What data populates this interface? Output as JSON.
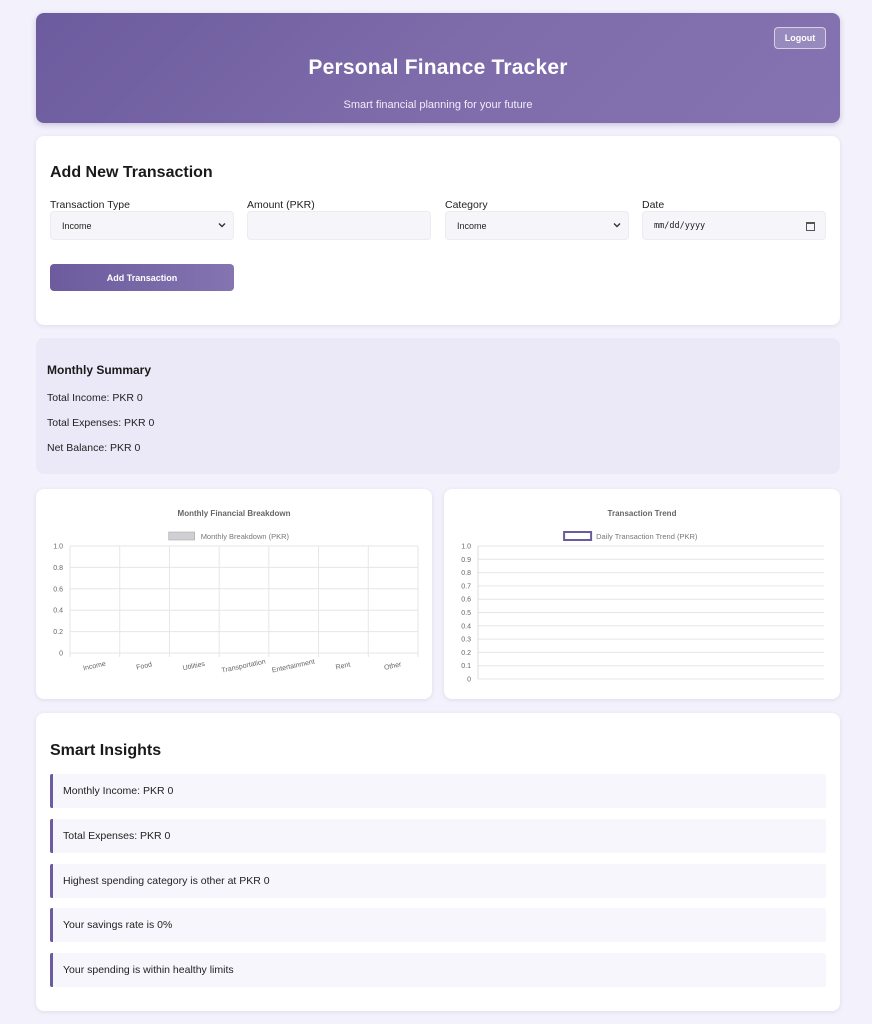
{
  "header": {
    "title": "Personal Finance Tracker",
    "subtitle": "Smart financial planning for your future",
    "logout_label": "Logout"
  },
  "form": {
    "heading": "Add New Transaction",
    "fields": [
      {
        "label": "Transaction Type",
        "value": "Income"
      },
      {
        "label": "Amount (PKR)",
        "value": ""
      },
      {
        "label": "Category",
        "value": "Income"
      },
      {
        "label": "Date",
        "value": "mm/dd/yyyy"
      }
    ],
    "submit_label": "Add Transaction"
  },
  "summary": {
    "heading": "Monthly Summary",
    "rows": [
      "Total Income: PKR 0",
      "Total Expenses: PKR 0",
      "Net Balance: PKR 0"
    ]
  },
  "chart_data": [
    {
      "type": "bar",
      "title": "Monthly Financial Breakdown",
      "categories": [
        "Income",
        "Food",
        "Utilities",
        "Transportation",
        "Entertainment",
        "Rent",
        "Other"
      ],
      "series": [
        {
          "name": "Monthly Breakdown (PKR)",
          "values": [
            0,
            0,
            0,
            0,
            0,
            0,
            0
          ]
        }
      ],
      "ylim": [
        0,
        1.0
      ],
      "yticks": [
        "0",
        "0.2",
        "0.4",
        "0.6",
        "0.8",
        "1.0"
      ],
      "grid": true,
      "legend": "top"
    },
    {
      "type": "line",
      "title": "Transaction Trend",
      "x": [],
      "series": [
        {
          "name": "Daily Transaction Trend (PKR)",
          "values": []
        }
      ],
      "ylim": [
        0,
        1.0
      ],
      "yticks": [
        "0",
        "0.1",
        "0.2",
        "0.3",
        "0.4",
        "0.5",
        "0.6",
        "0.7",
        "0.8",
        "0.9",
        "1.0"
      ],
      "grid": true,
      "legend": "top"
    }
  ],
  "insights": {
    "heading": "Smart Insights",
    "items": [
      "Monthly Income: PKR 0",
      "Total Expenses: PKR 0",
      "Highest spending category is other at PKR 0",
      "Your savings rate is 0%",
      "Your spending is within healthy limits"
    ]
  },
  "colors": {
    "accent": "#6c5b9e",
    "background": "#f3f1fb"
  }
}
